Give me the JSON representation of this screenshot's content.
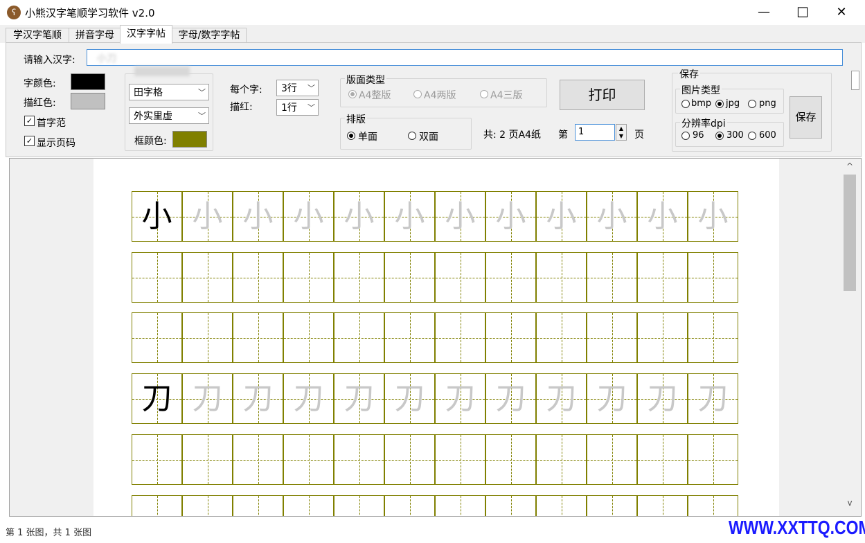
{
  "window": {
    "title": "小熊汉字笔顺学习软件 v2.0",
    "min_glyph": "—",
    "max_glyph": "☐",
    "close_glyph": "✕"
  },
  "tabs": [
    {
      "label": "学汉字笔顺"
    },
    {
      "label": "拼音字母"
    },
    {
      "label": "汉字字帖"
    },
    {
      "label": "字母/数字字帖"
    }
  ],
  "form": {
    "input_label": "请输入汉字:",
    "input_value": "小刀",
    "font_color_label": "字颜色:",
    "font_color": "#000000",
    "trace_color_label": "描红色:",
    "trace_color": "#c0c0c0",
    "first_sample_label": "首字范",
    "first_sample_checked": true,
    "show_page_number_label": "显示页码",
    "show_page_number_checked": true,
    "grid_type": "田字格",
    "border_style": "外实里虚",
    "frame_color_label": "框颜色:",
    "frame_color": "#808000",
    "per_char_label": "每个字:",
    "per_char_value": "3行",
    "trace_label": "描红:",
    "trace_value": "1行"
  },
  "layout_group": {
    "title": "版面类型",
    "options": [
      "A4整版",
      "A4两版",
      "A4三版"
    ],
    "selected": "A4整版"
  },
  "side_group": {
    "title": "排版",
    "options": [
      "单面",
      "双面"
    ],
    "selected": "单面"
  },
  "print_button": "打印",
  "pages": {
    "total_text": "共: 2 页A4纸",
    "page_prefix": "第",
    "page_value": "1",
    "page_suffix": "页"
  },
  "save_group": {
    "title": "保存",
    "image_type_title": "图片类型",
    "image_types": [
      "bmp",
      "jpg",
      "png"
    ],
    "image_type_selected": "jpg",
    "dpi_title": "分辨率dpi",
    "dpi_options": [
      "96",
      "300",
      "600"
    ],
    "dpi_selected": "300",
    "save_button": "保存"
  },
  "worksheet": {
    "grid_color": "#808000",
    "rows": [
      {
        "char": "小"
      },
      {
        "char": ""
      },
      {
        "char": ""
      },
      {
        "char": "刀"
      },
      {
        "char": ""
      },
      {
        "char": ""
      }
    ],
    "cells_per_row": 12
  },
  "status_text": "第 1 张图，共 1 张图",
  "watermark": "WWW.XXTTQ.COM",
  "scroll_up": "^",
  "scroll_down": "v"
}
